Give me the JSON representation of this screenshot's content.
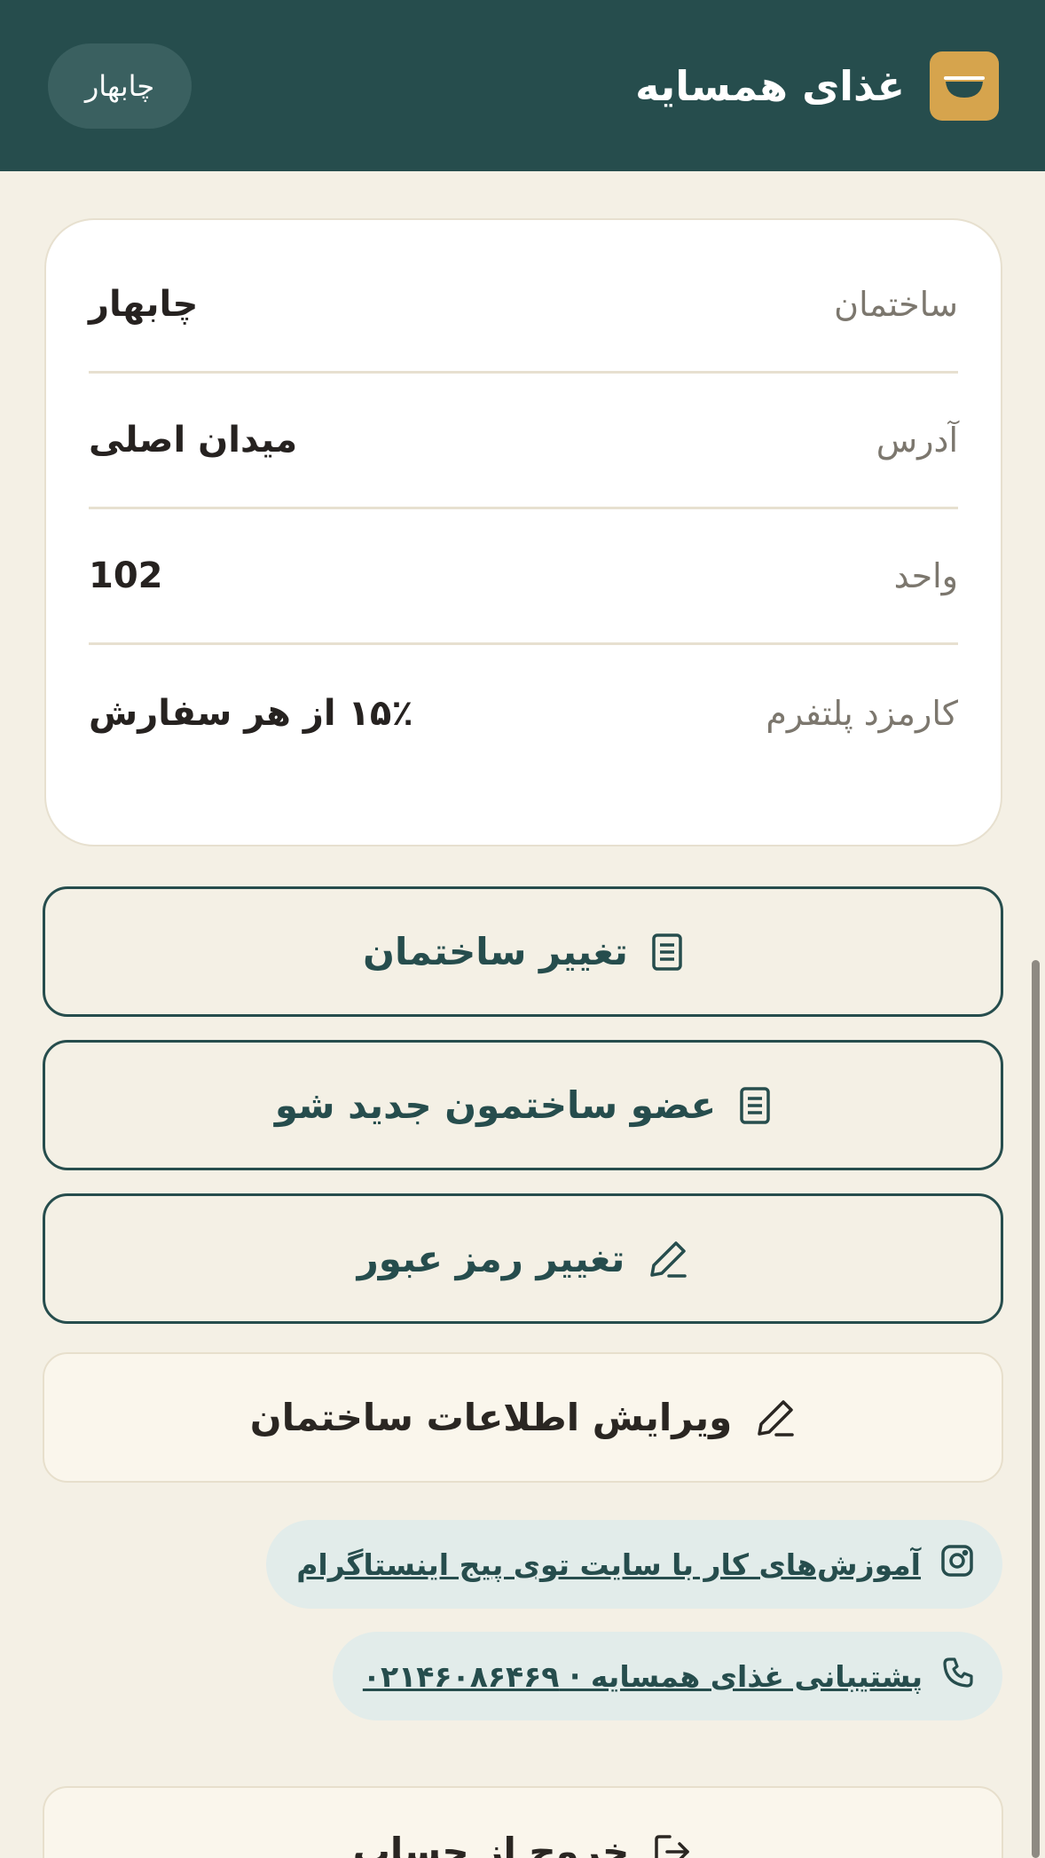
{
  "header": {
    "brand_title": "غذای همسایه",
    "city_button": "چابهار",
    "logo_icon": "bowl-icon"
  },
  "info": {
    "rows": [
      {
        "label": "ساختمان",
        "value": "چابهار"
      },
      {
        "label": "آدرس",
        "value": "میدان اصلی"
      },
      {
        "label": "واحد",
        "value": "102"
      },
      {
        "label": "کارمزد پلتفرم",
        "value": "۱۵٪ از هر سفارش"
      }
    ]
  },
  "actions": {
    "change_building": {
      "label": "تغییر ساختمان",
      "icon": "document-icon"
    },
    "join_building": {
      "label": "عضو ساختمون جدید شو",
      "icon": "document-icon"
    },
    "change_password": {
      "label": "تغییر رمز عبور",
      "icon": "pencil-icon"
    },
    "edit_building": {
      "label": "ویرایش اطلاعات ساختمان",
      "icon": "pencil-icon"
    },
    "logout": {
      "label": "خروج از حساب",
      "icon": "logout-icon"
    }
  },
  "links": {
    "instagram": {
      "label": "آموزش‌های کار با سایت توی پیج اینستاگرام",
      "icon": "instagram-icon"
    },
    "support": {
      "label": "پشتیبانی غذای همسایه · ۰۲۱۴۶۰۸۶۴۶۹",
      "icon": "phone-icon"
    }
  },
  "colors": {
    "header_bg": "#264d4d",
    "accent": "#d6a44d",
    "page_bg": "#f4f0e5"
  }
}
